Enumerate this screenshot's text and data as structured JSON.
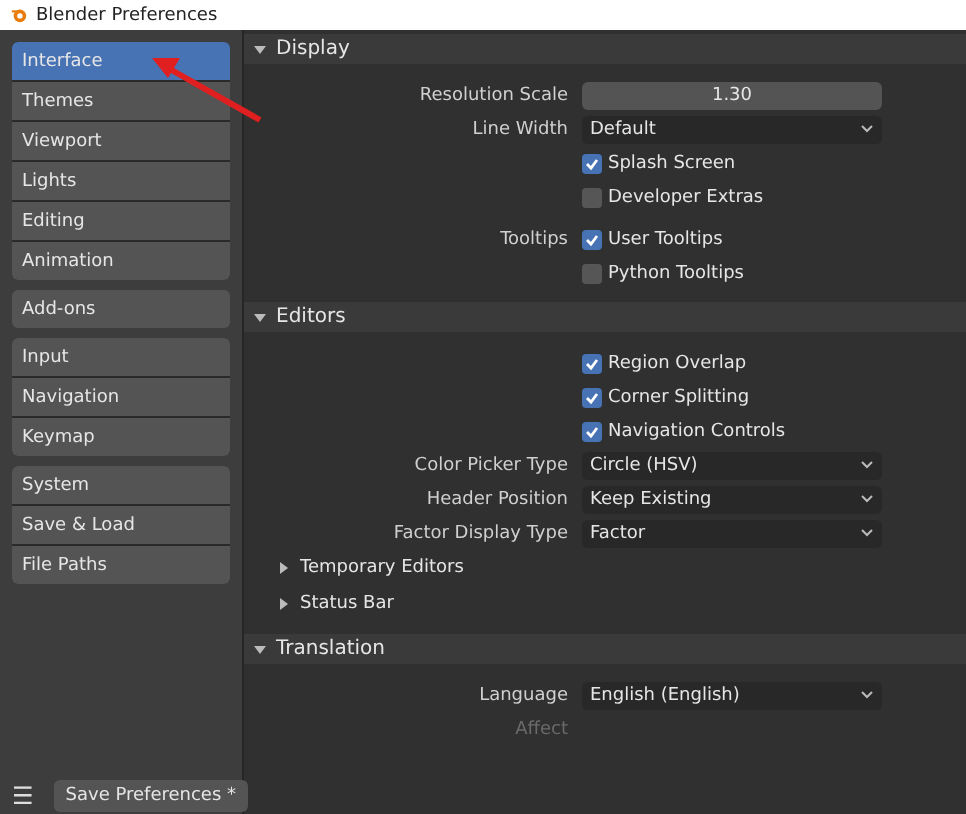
{
  "window": {
    "title": "Blender Preferences"
  },
  "sidebar": {
    "groups": [
      {
        "items": [
          {
            "label": "Interface",
            "selected": true
          },
          {
            "label": "Themes",
            "selected": false
          },
          {
            "label": "Viewport",
            "selected": false
          },
          {
            "label": "Lights",
            "selected": false
          },
          {
            "label": "Editing",
            "selected": false
          },
          {
            "label": "Animation",
            "selected": false
          }
        ]
      },
      {
        "items": [
          {
            "label": "Add-ons",
            "selected": false
          }
        ]
      },
      {
        "items": [
          {
            "label": "Input",
            "selected": false
          },
          {
            "label": "Navigation",
            "selected": false
          },
          {
            "label": "Keymap",
            "selected": false
          }
        ]
      },
      {
        "items": [
          {
            "label": "System",
            "selected": false
          },
          {
            "label": "Save & Load",
            "selected": false
          },
          {
            "label": "File Paths",
            "selected": false
          }
        ]
      }
    ]
  },
  "sections": [
    {
      "title": "Display",
      "expanded": true,
      "rows": [
        {
          "kind": "slider",
          "label": "Resolution Scale",
          "value": "1.30"
        },
        {
          "kind": "dropdown",
          "label": "Line Width",
          "value": "Default"
        },
        {
          "kind": "checkbox",
          "text": "Splash Screen",
          "checked": true
        },
        {
          "kind": "checkbox",
          "text": "Developer Extras",
          "checked": false
        },
        {
          "kind": "spacer"
        },
        {
          "kind": "checkbox",
          "label": "Tooltips",
          "text": "User Tooltips",
          "checked": true
        },
        {
          "kind": "checkbox",
          "text": "Python Tooltips",
          "checked": false
        }
      ]
    },
    {
      "title": "Editors",
      "expanded": true,
      "rows": [
        {
          "kind": "checkbox",
          "text": "Region Overlap",
          "checked": true
        },
        {
          "kind": "checkbox",
          "text": "Corner Splitting",
          "checked": true
        },
        {
          "kind": "checkbox",
          "text": "Navigation Controls",
          "checked": true
        },
        {
          "kind": "dropdown",
          "label": "Color Picker Type",
          "value": "Circle (HSV)"
        },
        {
          "kind": "dropdown",
          "label": "Header Position",
          "value": "Keep Existing"
        },
        {
          "kind": "dropdown",
          "label": "Factor Display Type",
          "value": "Factor"
        },
        {
          "kind": "subpanel",
          "text": "Temporary Editors",
          "expanded": false
        },
        {
          "kind": "subpanel",
          "text": "Status Bar",
          "expanded": false
        }
      ]
    },
    {
      "title": "Translation",
      "expanded": true,
      "rows": [
        {
          "kind": "dropdown",
          "label": "Language",
          "value": "English (English)"
        },
        {
          "kind": "label",
          "label": "Affect"
        }
      ]
    }
  ],
  "footer": {
    "menu_icon": "☰",
    "save_button": "Save Preferences *"
  }
}
